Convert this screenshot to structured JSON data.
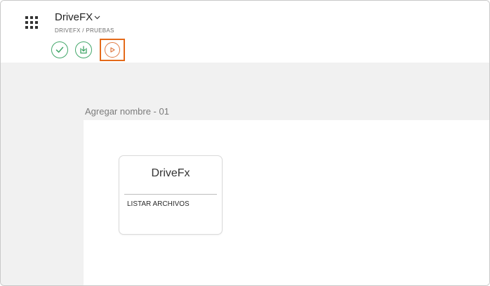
{
  "header": {
    "app_title": "DriveFX",
    "breadcrumb": "DRIVEFX / PRUEBAS",
    "apps_icon": "apps-grid-icon",
    "title_chevron_icon": "chevron-down-icon"
  },
  "toolbar": {
    "buttons": [
      {
        "name": "validate",
        "icon": "check-icon"
      },
      {
        "name": "save",
        "icon": "download-icon"
      },
      {
        "name": "run",
        "icon": "play-icon",
        "highlighted": true
      }
    ]
  },
  "colors": {
    "accent_green": "#43a76a",
    "run_orange": "#e07a43",
    "highlight_orange": "#e46a1a",
    "canvas_bg": "#f1f1f1"
  },
  "section": {
    "title": "Agregar nombre - 01"
  },
  "card": {
    "title": "DriveFx",
    "items": [
      "LISTAR ARCHIVOS"
    ]
  }
}
